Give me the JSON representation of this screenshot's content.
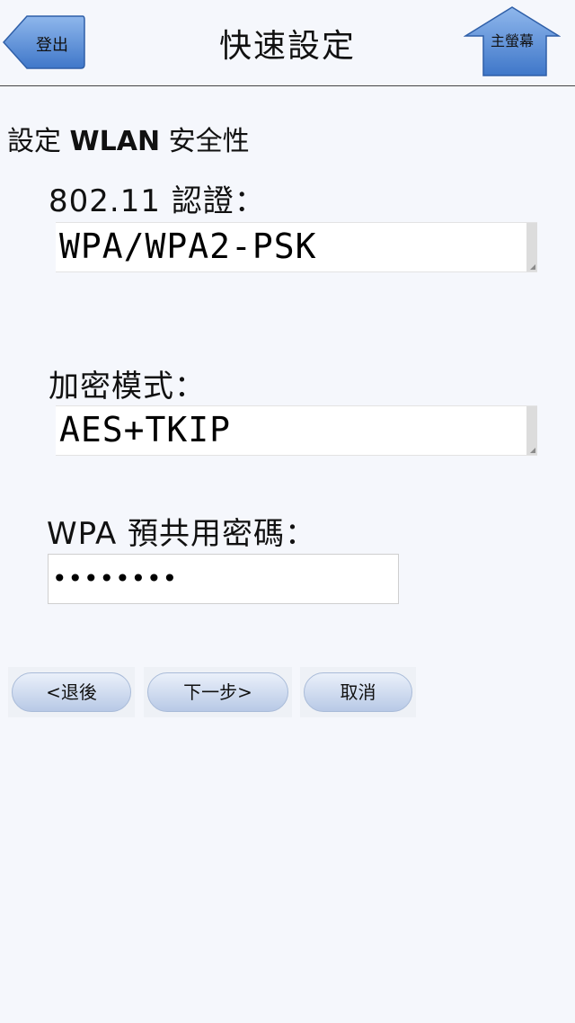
{
  "header": {
    "logout_label": "登出",
    "title": "快速設定",
    "home_label": "主螢幕"
  },
  "section_title_prefix": "設定 ",
  "section_title_bold": "WLAN",
  "section_title_suffix": " 安全性",
  "fields": {
    "auth": {
      "label": "802.11 認證：",
      "value": "WPA/WPA2-PSK"
    },
    "encryption": {
      "label": "加密模式：",
      "value": "AES+TKIP"
    },
    "psk": {
      "label": "WPA 預共用密碼：",
      "value": "••••••••"
    }
  },
  "buttons": {
    "back": "<退後",
    "next": "下一步>",
    "cancel": "取消"
  },
  "colors": {
    "background": "#f5f7fc",
    "button_blue": "#5b8fd6"
  }
}
